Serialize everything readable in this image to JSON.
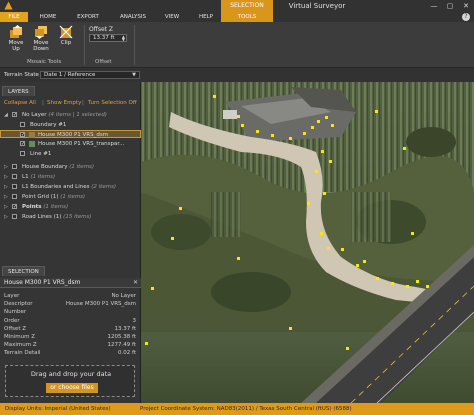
{
  "app": {
    "title": "Virtual Surveyor"
  },
  "window": {
    "minimize": "—",
    "maximize": "▢",
    "close": "✕"
  },
  "context_tab": {
    "label": "SELECTION"
  },
  "tabs": [
    "FILE",
    "HOME",
    "EXPORT",
    "ANALYSIS",
    "VIEW",
    "HELP",
    "TOOLS"
  ],
  "ribbon": {
    "move_up": [
      "Move",
      "Up"
    ],
    "move_down": [
      "Move",
      "Down"
    ],
    "clip": "Clip",
    "group_mosaic": "Mosaic Tools",
    "offset_label": "Offset Z",
    "offset_value": "13.37 ft",
    "group_offset": "Offset"
  },
  "terrain": {
    "label": "Terrain State",
    "value": "Date 1 / Reference"
  },
  "layers_panel": {
    "tab": "LAYERS",
    "actions": [
      "Collapse All",
      "Show Empty",
      "Turn Selection Off"
    ],
    "rows": [
      {
        "name": "No Layer",
        "count": "(4 items | 1 selected)"
      },
      {
        "name": "Boundary #1",
        "count": ""
      },
      {
        "name": "House M300 P1 VRS_dsm",
        "count": ""
      },
      {
        "name": "House M300 P1 VRS_transpar...",
        "count": ""
      },
      {
        "name": "Line #1",
        "count": ""
      },
      {
        "name": "House Boundary",
        "count": "(1 items)"
      },
      {
        "name": "L1",
        "count": "(1 items)"
      },
      {
        "name": "L1 Boundaries and Lines",
        "count": "(2 items)"
      },
      {
        "name": "Point Grid (1)",
        "count": "(1 items)"
      },
      {
        "name": "Points",
        "count": "(1 items)"
      },
      {
        "name": "Road Lines (1)",
        "count": "(15 items)"
      }
    ]
  },
  "selection_panel": {
    "tab": "SELECTION",
    "title": "House M300 P1 VRS_dsm",
    "properties": [
      {
        "key": "Layer",
        "value": "No Layer"
      },
      {
        "key": "Descriptor",
        "value": "House M300 P1 VRS_dsm"
      },
      {
        "key": "Number",
        "value": ""
      },
      {
        "key": "Order",
        "value": "3"
      },
      {
        "key": "Offset Z",
        "value": "13.37 ft"
      },
      {
        "key": "Minimum Z",
        "value": "1205.38 ft"
      },
      {
        "key": "Maximum Z",
        "value": "1277.49 ft"
      },
      {
        "key": "Terrain Detail",
        "value": "0.02 ft"
      }
    ]
  },
  "dropzone": {
    "text": "Drag and drop your data",
    "button": "or choose files"
  },
  "status": {
    "units": "Display Units: Imperial (United States)",
    "crs": "Project Coordinate System: NAD83(2011) / Texas South Central (ftUS) (6588)"
  },
  "colors": {
    "accent": "#e09a1a",
    "selection": "#c99639",
    "marker": "#ffe600"
  }
}
